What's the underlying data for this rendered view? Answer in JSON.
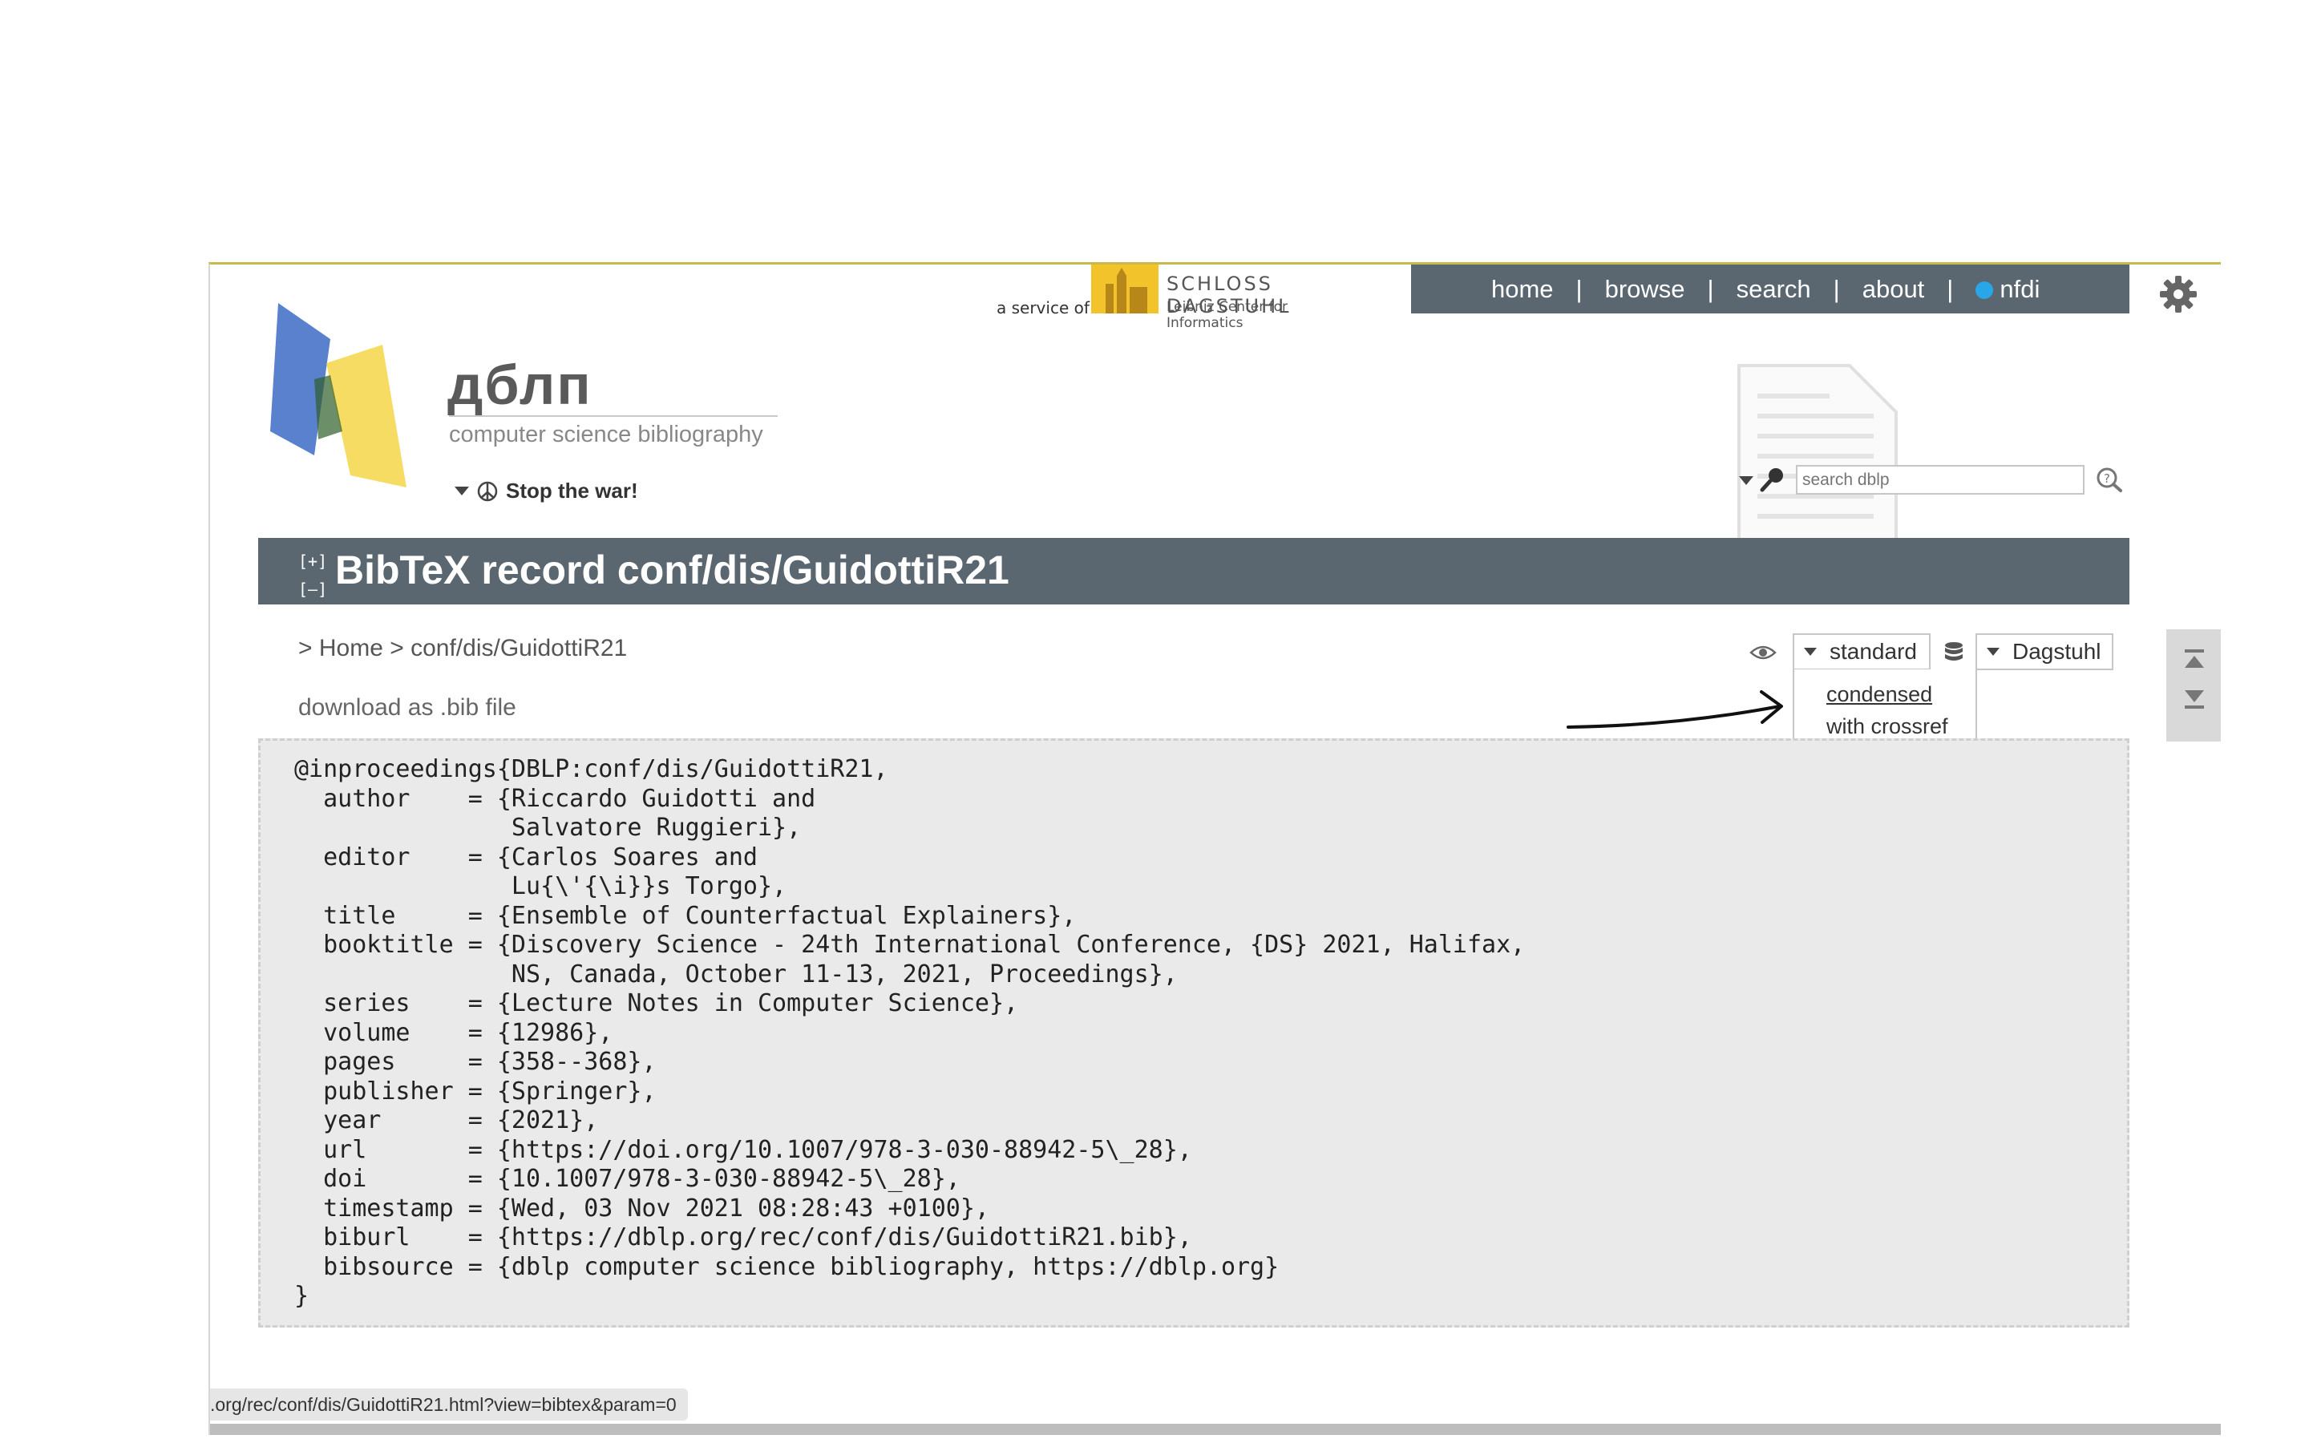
{
  "header": {
    "service_of": "a service of",
    "dagstuhl_name": "SCHLOSS DAGSTUHL",
    "dagstuhl_sub": "Leibniz Center for Informatics"
  },
  "topnav": {
    "items": [
      "home",
      "browse",
      "search",
      "about",
      "nfdi"
    ]
  },
  "logo": {
    "title": "дблп",
    "subtitle": "computer science bibliography"
  },
  "stop_war": "Stop the war!",
  "search": {
    "placeholder": "search dblp"
  },
  "page": {
    "expand_plus": "[+]",
    "expand_minus": "[–]",
    "title": "BibTeX record conf/dis/GuidottiR21",
    "breadcrumb_prefix": "> ",
    "breadcrumb_home": "Home",
    "breadcrumb_sep": " > ",
    "breadcrumb_current": "conf/dis/GuidottiR21",
    "download": "download as .bib file"
  },
  "view_controls": {
    "style_selected": "standard",
    "style_options": [
      "condensed",
      "with crossref"
    ],
    "source_selected": "Dagstuhl"
  },
  "bibtex": "@inproceedings{DBLP:conf/dis/GuidottiR21,\n  author    = {Riccardo Guidotti and\n               Salvatore Ruggieri},\n  editor    = {Carlos Soares and\n               Lu{\\'{\\i}}s Torgo},\n  title     = {Ensemble of Counterfactual Explainers},\n  booktitle = {Discovery Science - 24th International Conference, {DS} 2021, Halifax,\n               NS, Canada, October 11-13, 2021, Proceedings},\n  series    = {Lecture Notes in Computer Science},\n  volume    = {12986},\n  pages     = {358--368},\n  publisher = {Springer},\n  year      = {2021},\n  url       = {https://doi.org/10.1007/978-3-030-88942-5\\_28},\n  doi       = {10.1007/978-3-030-88942-5\\_28},\n  timestamp = {Wed, 03 Nov 2021 08:28:43 +0100},\n  biburl    = {https://dblp.org/rec/conf/dis/GuidottiR21.bib},\n  bibsource = {dblp computer science bibliography, https://dblp.org}\n}",
  "status_url": ".org/rec/conf/dis/GuidottiR21.html?view=bibtex&param=0",
  "colors": {
    "nav_bg": "#5b6770",
    "accent_yellow": "#f3c32b",
    "nfdi_blue": "#29a6e8",
    "panel_bg": "#eaeaea"
  }
}
